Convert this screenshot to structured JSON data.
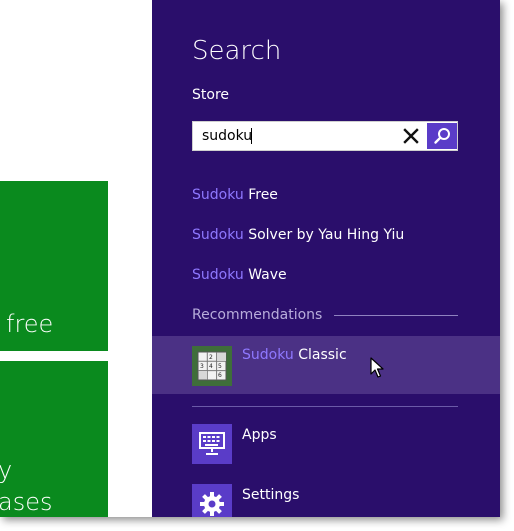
{
  "left_tiles": {
    "tile1_text": "free",
    "tile2_line1": "y",
    "tile2_line2": "ases"
  },
  "charm": {
    "title": "Search",
    "scope": "Store",
    "search": {
      "value": "sudoku"
    },
    "suggestions": [
      {
        "highlight": "Sudoku",
        "rest": " Free"
      },
      {
        "highlight": "Sudoku",
        "rest": " Solver by Yau Hing Yiu"
      },
      {
        "highlight": "Sudoku",
        "rest": " Wave"
      }
    ],
    "recommendations_label": "Recommendations",
    "recommendation": {
      "highlight": "Sudoku",
      "rest": " Classic"
    },
    "categories": [
      {
        "label": "Apps",
        "icon": "keyboard-monitor-icon"
      },
      {
        "label": "Settings",
        "icon": "gear-icon"
      }
    ]
  },
  "colors": {
    "charm_bg": "#2a0e6b",
    "accent": "#5a3cc8",
    "match_highlight": "#8f78ff",
    "tile_green": "#0a8a1e",
    "hover_row": "#4b3185"
  }
}
